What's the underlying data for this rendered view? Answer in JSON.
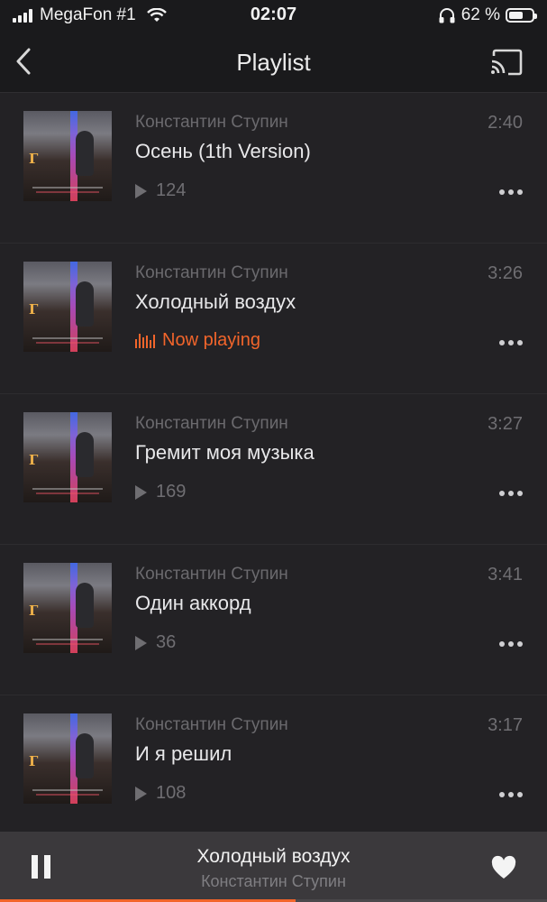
{
  "status_bar": {
    "carrier": "MegaFon #1",
    "time": "02:07",
    "battery_percent": "62 %",
    "battery_level": 0.62
  },
  "nav": {
    "title": "Playlist",
    "back_icon": "chevron-left-icon",
    "cast_icon": "cast-icon"
  },
  "tracks": [
    {
      "artist": "Константин Ступин",
      "title": "Осень (1th Version)",
      "duration": "2:40",
      "plays": "124",
      "now_playing": false
    },
    {
      "artist": "Константин Ступин",
      "title": "Холодный воздух",
      "duration": "3:26",
      "status": "Now playing",
      "now_playing": true
    },
    {
      "artist": "Константин Ступин",
      "title": "Гремит моя музыка",
      "duration": "3:27",
      "plays": "169",
      "now_playing": false
    },
    {
      "artist": "Константин Ступин",
      "title": "Один аккорд",
      "duration": "3:41",
      "plays": "36",
      "now_playing": false
    },
    {
      "artist": "Константин Ступин",
      "title": "И я решил",
      "duration": "3:17",
      "plays": "108",
      "now_playing": false
    }
  ],
  "mini_player": {
    "title": "Холодный воздух",
    "artist": "Константин Ступин",
    "progress": 0.54
  },
  "colors": {
    "accent": "#f2652b",
    "background": "#232225",
    "header": "#1a1a1c",
    "mini_player": "#3b393c"
  }
}
